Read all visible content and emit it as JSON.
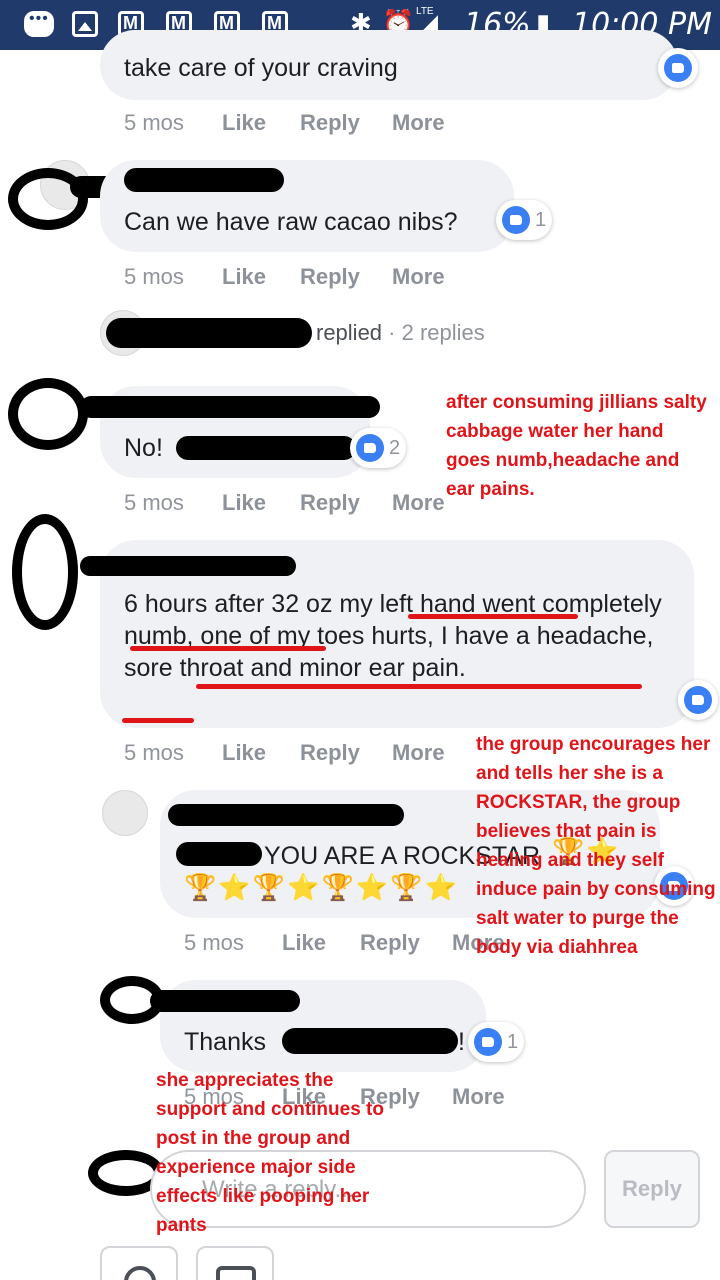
{
  "status_bar": {
    "battery": "16%",
    "time": "10:00 PM",
    "network": "LTE"
  },
  "comments": [
    {
      "text": "take care of your craving",
      "time": "5 mos",
      "like_label": "Like",
      "reply_label": "Reply",
      "more_label": "More"
    },
    {
      "text": "Can we have raw cacao nibs?",
      "likes": "1",
      "time": "5 mos",
      "like_label": "Like",
      "reply_label": "Reply",
      "more_label": "More"
    },
    {
      "replied_text": "replied",
      "replies_count": "· 2 replies"
    },
    {
      "text": "No!",
      "likes": "2",
      "time": "5 mos",
      "like_label": "Like",
      "reply_label": "Reply",
      "more_label": "More"
    },
    {
      "text": "6 hours after 32 oz my left hand went completely numb, one of my toes hurts, I have a headache, sore throat and minor ear pain.",
      "time": "5 mos",
      "like_label": "Like",
      "reply_label": "Reply",
      "more_label": "More"
    },
    {
      "text": "YOU ARE A ROCKSTAR",
      "emoji": "🏆⭐🏆⭐🏆⭐🏆⭐",
      "emoji_tail": "🏆⭐",
      "time": "5 mos",
      "like_label": "Like",
      "reply_label": "Reply",
      "more_label": "More"
    },
    {
      "text": "Thanks",
      "text_end": "!",
      "likes": "1",
      "time": "5 mos",
      "like_label": "Like",
      "reply_label": "Reply",
      "more_label": "More"
    }
  ],
  "composer": {
    "placeholder": "Write a reply...",
    "button": "Reply"
  },
  "annotations": {
    "a1": "after consuming jillians salty cabbage water her hand goes numb,headache and ear pains.",
    "a2": "the group encourages her and tells her she is a ROCKSTAR, the group believes that pain is healing and they self induce pain by consuming salt water to purge the body via diahhrea",
    "a3": "she appreciates the support and continues to post in the group and experience major side effects like pooping her pants"
  },
  "colors": {
    "status_bar": "#1f3a6b",
    "bubble": "#f0f1f4",
    "like_blue": "#3b7ff5",
    "annotation_red": "#e0151a"
  }
}
